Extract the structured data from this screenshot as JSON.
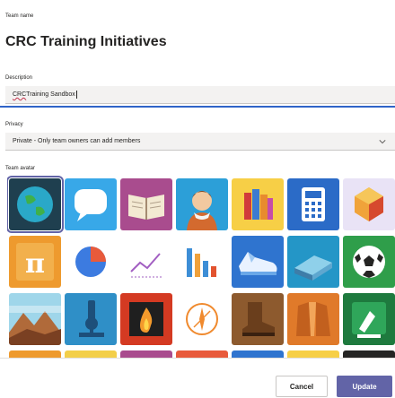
{
  "team_name": {
    "label": "Team name",
    "value": "CRC Training Initiatives"
  },
  "description": {
    "label": "Description",
    "value_prefix": "CRC",
    "value_suffix": " Training Sandbox"
  },
  "privacy": {
    "label": "Privacy",
    "value": "Private - Only team owners can add members"
  },
  "avatar": {
    "label": "Team avatar",
    "selected": "earth-icon",
    "icons": [
      "earth-icon",
      "speech-bubble-icon",
      "open-book-icon",
      "shakespeare-icon",
      "books-stack-icon",
      "calculator-icon",
      "geometric-shapes-icon",
      "pi-icon",
      "pie-chart-icon",
      "line-graph-icon",
      "bar-chart-icon",
      "running-shoe-icon",
      "ruler-block-icon",
      "soccer-ball-icon",
      "landscape-icon",
      "microscope-icon",
      "fire-icon",
      "compass-icon",
      "boot-icon",
      "coats-icon",
      "paintbrush-easel-icon"
    ]
  },
  "footer": {
    "cancel_label": "Cancel",
    "update_label": "Update"
  },
  "colors": {
    "accent": "#6264a7",
    "focus_line": "#2f64c8"
  }
}
